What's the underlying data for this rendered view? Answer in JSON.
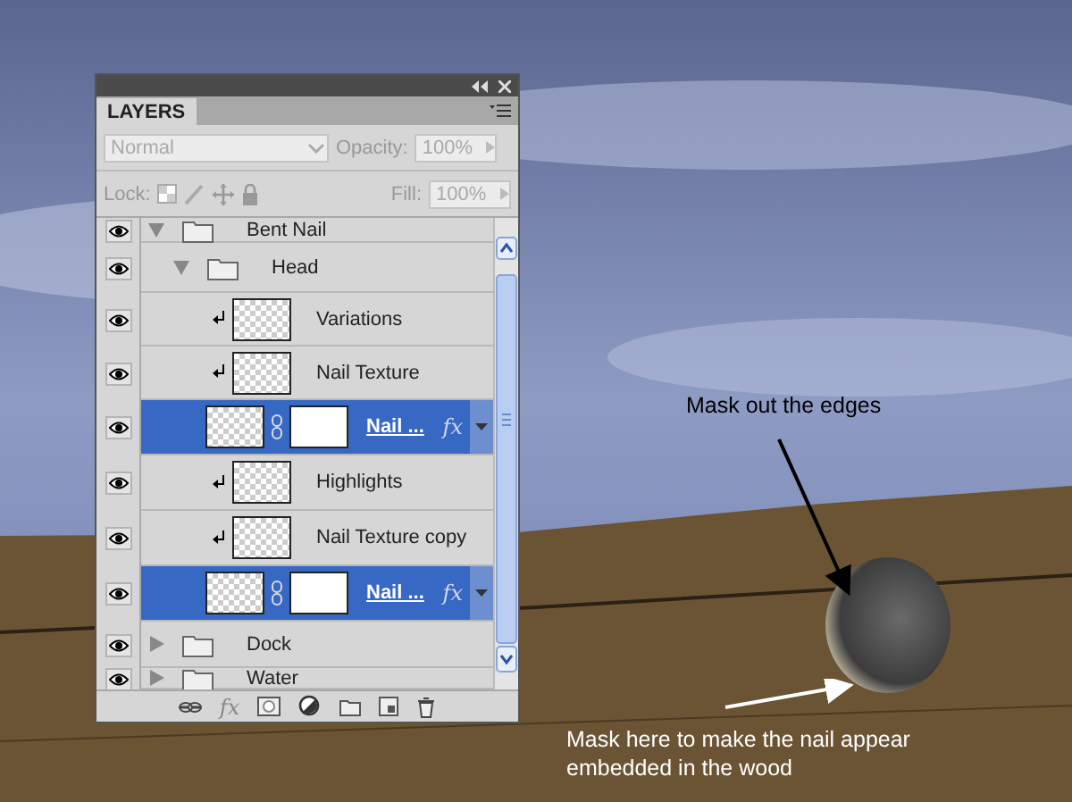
{
  "panel": {
    "title": "LAYERS",
    "blend_mode": {
      "placeholder": "Normal",
      "disabled": true
    },
    "opacity": {
      "label": "Opacity:",
      "value": "100%",
      "disabled": true
    },
    "lock": {
      "label": "Lock:"
    },
    "fill": {
      "label": "Fill:",
      "value": "100%",
      "disabled": true
    },
    "layers": [
      {
        "kind": "group",
        "name": "Bent Nail",
        "visible": true,
        "selected": false,
        "expanded": true,
        "children": [
          {
            "kind": "group",
            "name": "Head",
            "visible": true,
            "selected": false,
            "expanded": true,
            "children": [
              {
                "kind": "clipped",
                "name": "Variations",
                "visible": true,
                "selected": false
              },
              {
                "kind": "clipped",
                "name": "Nail Texture",
                "visible": true,
                "selected": false
              },
              {
                "kind": "masked",
                "name": "Nail ...",
                "visible": true,
                "selected": true,
                "effects": "fx"
              },
              {
                "kind": "clipped",
                "name": "Highlights",
                "visible": true,
                "selected": false
              },
              {
                "kind": "clipped",
                "name": "Nail Texture copy",
                "visible": true,
                "selected": false
              },
              {
                "kind": "masked",
                "name": "Nail ...",
                "visible": true,
                "selected": true,
                "effects": "fx"
              }
            ]
          }
        ]
      },
      {
        "kind": "group",
        "name": "Dock",
        "visible": true,
        "selected": false,
        "expanded": false
      },
      {
        "kind": "group",
        "name": "Water",
        "visible": true,
        "selected": false,
        "expanded": false
      }
    ],
    "toolbar": [
      {
        "kind": "link"
      },
      {
        "kind": "fx",
        "text": "fx"
      },
      {
        "kind": "mask"
      },
      {
        "kind": "adjustment"
      },
      {
        "kind": "folder"
      },
      {
        "kind": "new"
      },
      {
        "kind": "trash"
      }
    ]
  },
  "annotations": [
    {
      "kind": "dark",
      "text": "Mask out the edges"
    },
    {
      "kind": "light",
      "text": "Mask here to make the nail appear embedded in the wood"
    }
  ]
}
